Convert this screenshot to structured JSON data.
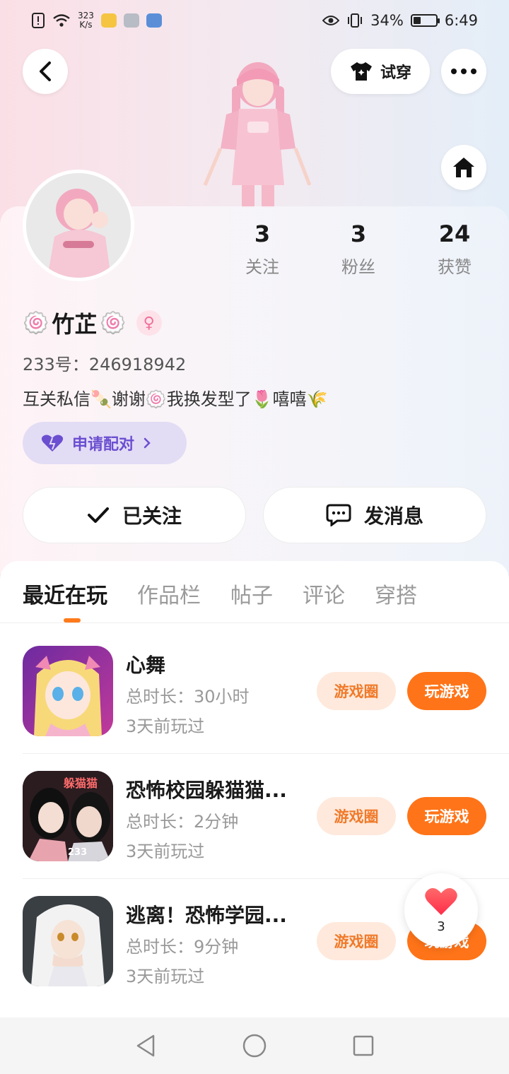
{
  "status_bar": {
    "net_speed_value": "323",
    "net_speed_unit": "K/s",
    "battery": "34%",
    "battery_level": 0.34,
    "time": "6:49"
  },
  "header": {
    "back_icon": "chevron-left-icon",
    "tryon_label": "试穿",
    "more_icon": "more-horizontal-icon",
    "home_icon": "home-icon"
  },
  "profile": {
    "name": "竹芷",
    "gender": "female",
    "uid": "233号：246918942",
    "bio": "互关私信🍡谢谢🍥我换发型了🌷嘻嘻🌾",
    "pair_label": "申请配对",
    "stats": [
      {
        "value": "3",
        "label": "关注"
      },
      {
        "value": "3",
        "label": "粉丝"
      },
      {
        "value": "24",
        "label": "获赞"
      }
    ],
    "followed_label": "已关注",
    "message_label": "发消息"
  },
  "tabs": [
    "最近在玩",
    "作品栏",
    "帖子",
    "评论",
    "穿搭"
  ],
  "games": [
    {
      "title": "心舞",
      "duration": "总时长：30小时",
      "last_played": "3天前玩过",
      "circle_label": "游戏圈",
      "play_label": "玩游戏"
    },
    {
      "title": "恐怖校园躲猫猫...",
      "duration": "总时长：2分钟",
      "last_played": "3天前玩过",
      "circle_label": "游戏圈",
      "play_label": "玩游戏",
      "icon_text": "躲猫猫",
      "icon_badge": "233"
    },
    {
      "title": "逃离！恐怖学园...",
      "duration": "总时长：9分钟",
      "last_played": "3天前玩过",
      "circle_label": "游戏圈",
      "play_label": "玩游戏"
    }
  ],
  "like_fab": {
    "count": "3",
    "icon": "heart-icon"
  },
  "colors": {
    "accent": "#ff7418",
    "accent_soft": "#ffe9dc",
    "pair_purple": "#6b4fd0"
  }
}
